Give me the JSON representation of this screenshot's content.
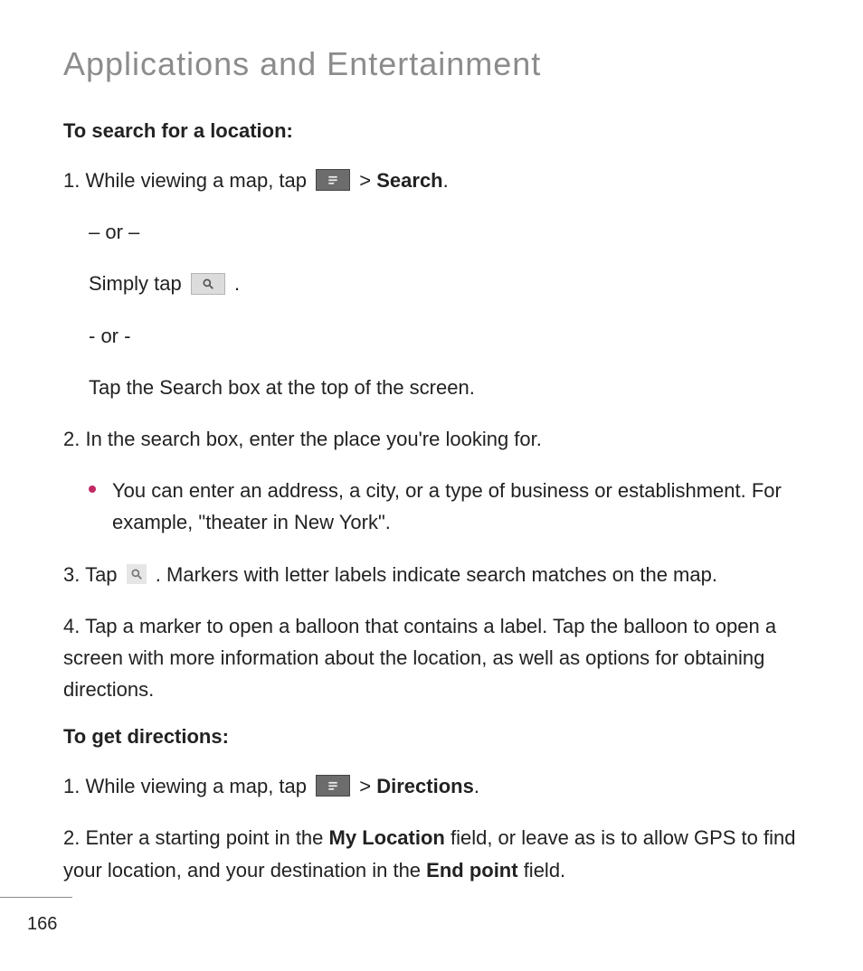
{
  "title": "Applications and Entertainment",
  "section1": {
    "heading": "To search for a location:",
    "step1_pre": "1. While viewing a map, tap ",
    "step1_post_gt": " > ",
    "step1_bold": "Search",
    "step1_period": ".",
    "or1": "– or –",
    "simply_pre": "Simply tap ",
    "simply_post": " .",
    "or2": "- or -",
    "tap_search_box": "Tap the Search box at the top of the screen.",
    "step2": "2. In the search box, enter the place you're looking for.",
    "bullet": "You can enter an address, a city, or a type of business or establishment. For example, \"theater in New York\".",
    "step3_pre": "3. Tap ",
    "step3_post": " . Markers with letter labels indicate search matches on the map.",
    "step4": "4. Tap a marker to open a balloon that contains a label. Tap the balloon to open a screen with more information about the location, as well as options for obtaining directions."
  },
  "section2": {
    "heading": "To get directions:",
    "step1_pre": "1. While viewing a map, tap ",
    "step1_gt": " > ",
    "step1_bold": "Directions",
    "step1_period": ".",
    "step2_pre": "2. Enter a starting point in the ",
    "step2_b1": "My Location",
    "step2_mid": " field, or leave as is to allow GPS to find your location, and your destination in the ",
    "step2_b2": "End point",
    "step2_post": " field."
  },
  "page_number": "166"
}
